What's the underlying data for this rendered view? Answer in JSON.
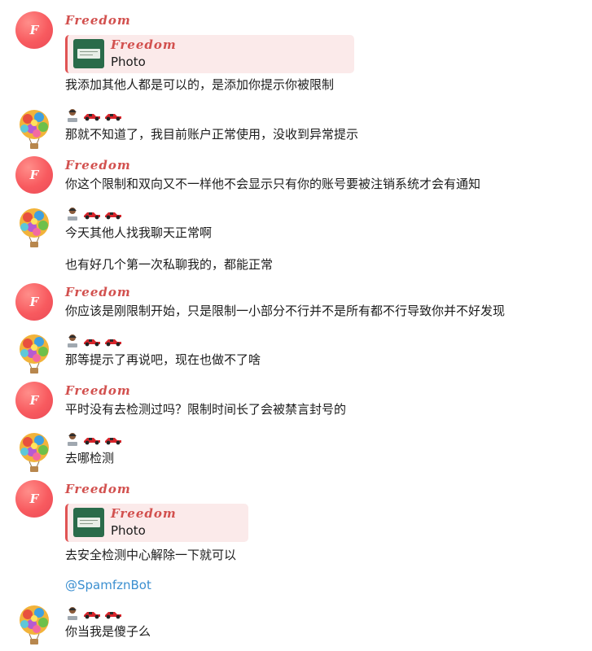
{
  "users": {
    "freedom": {
      "name": "Freedom",
      "avatar_letter": "F",
      "color": "#d2504e"
    },
    "other": {
      "name_icons": [
        "man-technologist-icon",
        "racing-car-icon",
        "racing-car-icon"
      ]
    }
  },
  "messages": [
    {
      "sender": "Freedom",
      "reply": {
        "name": "Freedom",
        "text": "Photo"
      },
      "text": "我添加其他人都是可以的，是添加你提示你被限制"
    },
    {
      "sender": "other",
      "text": "那就不知道了，我目前账户正常使用，没收到异常提示"
    },
    {
      "sender": "Freedom",
      "text": "你这个限制和双向又不一样他不会显示只有你的账号要被注销系统才会有通知"
    },
    {
      "sender": "other",
      "text": "今天其他人找我聊天正常啊",
      "text2": "也有好几个第一次私聊我的，都能正常"
    },
    {
      "sender": "Freedom",
      "text": "你应该是刚限制开始，只是限制一小部分不行并不是所有都不行导致你并不好发现"
    },
    {
      "sender": "other",
      "text": "那等提示了再说吧，现在也做不了啥"
    },
    {
      "sender": "Freedom",
      "text": "平时没有去检测过吗？限制时间长了会被禁言封号的"
    },
    {
      "sender": "other",
      "text": "去哪检测"
    },
    {
      "sender": "Freedom",
      "reply": {
        "name": "Freedom",
        "text": "Photo"
      },
      "text": "去安全检测中心解除一下就可以",
      "mention": "@SpamfznBot"
    },
    {
      "sender": "other",
      "text": "你当我是傻子么"
    }
  ]
}
